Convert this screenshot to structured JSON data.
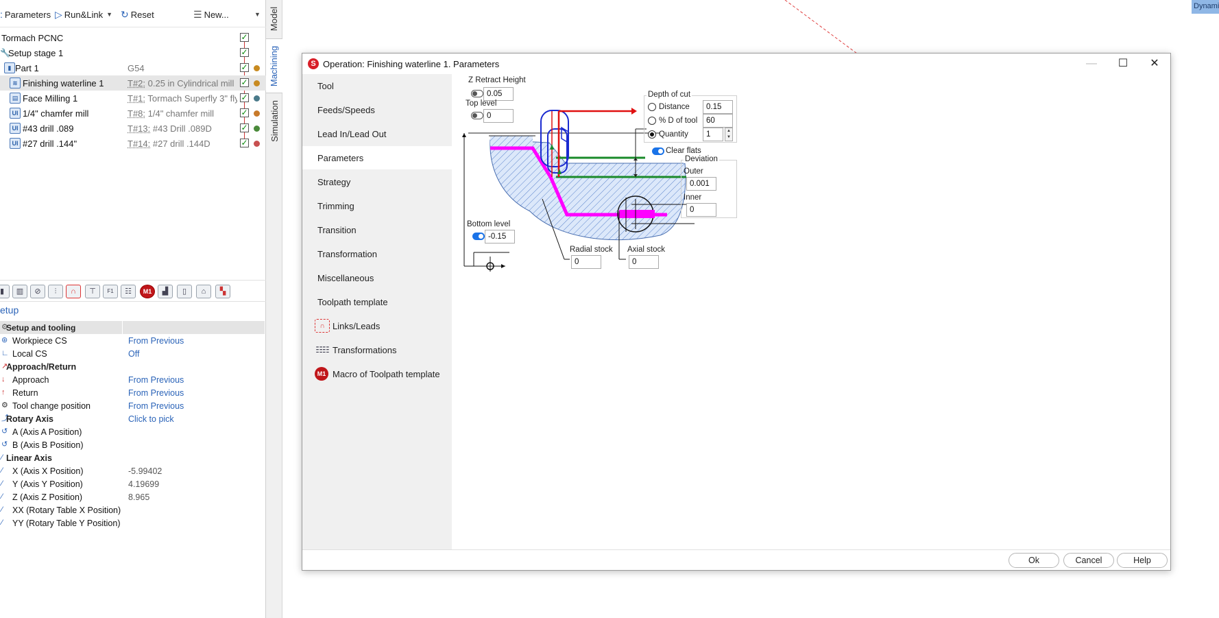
{
  "toolbar": {
    "parameters_label": "Parameters",
    "runlink_label": "Run&Link",
    "reset_label": "Reset",
    "new_label": "New..."
  },
  "tree": {
    "machine": "Tormach PCNC",
    "setup": "Setup stage 1",
    "part": {
      "name": "Part 1",
      "cs": "G54"
    },
    "operations": [
      {
        "name": "Finishing waterline 1",
        "tool_num": "T#2:",
        "tool": " 0.25 in Cylindrical mill",
        "dot": "#c88a20"
      },
      {
        "name": "Face Milling 1",
        "tool_num": "T#1:",
        "tool": " Tormach Superfly 3\" fly",
        "dot": "#4a7a8a"
      },
      {
        "name": "1/4\" chamfer mill",
        "tool_num": "T#8:",
        "tool": " 1/4\" chamfer mill",
        "dot": "#c87a2a"
      },
      {
        "name": "#43 drill .089",
        "tool_num": "T#13:",
        "tool": " #43  Drill .089D",
        "dot": "#4a8a3a"
      },
      {
        "name": "#27 drill .144\"",
        "tool_num": "T#14:",
        "tool": " #27 drill .144D",
        "dot": "#c85050"
      }
    ]
  },
  "side_tabs": {
    "model": "Model",
    "machining": "Machining",
    "simulation": "Simulation"
  },
  "setup_link": "etup",
  "props": {
    "group_setup": "Setup and tooling",
    "workpiece_cs": {
      "name": "Workpiece CS",
      "value": "From Previous"
    },
    "local_cs": {
      "name": "Local CS",
      "value": "Off"
    },
    "group_approach": "Approach/Return",
    "approach": {
      "name": "Approach",
      "value": "From Previous"
    },
    "return": {
      "name": "Return",
      "value": "From Previous"
    },
    "tool_change": {
      "name": "Tool change position",
      "value": "From Previous"
    },
    "group_rotary": "Rotary Axis",
    "rotary_value": "Click to pick",
    "axis_a": {
      "name": "A (Axis A Position)"
    },
    "axis_b": {
      "name": "B (Axis B Position)"
    },
    "group_linear": "Linear Axis",
    "axis_x": {
      "name": "X (Axis X Position)",
      "value": "-5.99402"
    },
    "axis_y": {
      "name": "Y (Axis Y Position)",
      "value": "4.19699"
    },
    "axis_z": {
      "name": "Z (Axis Z Position)",
      "value": "8.965"
    },
    "axis_xx": {
      "name": "XX (Rotary Table X Position)"
    },
    "axis_yy": {
      "name": "YY (Rotary Table Y Position)"
    }
  },
  "badge": "Dynami",
  "dialog": {
    "title": "Operation: Finishing waterline 1. Parameters",
    "nav": {
      "tool": "Tool",
      "feeds": "Feeds/Speeds",
      "lead": "Lead In/Lead Out",
      "parameters": "Parameters",
      "strategy": "Strategy",
      "trimming": "Trimming",
      "transition": "Transition",
      "transformation": "Transformation",
      "misc": "Miscellaneous",
      "toolpath": "Toolpath template",
      "links": "Links/Leads",
      "transformations": "Transformations",
      "macro": "Macro of Toolpath template"
    },
    "params": {
      "z_retract": {
        "label": "Z Retract Height",
        "value": "0.05"
      },
      "top_level": {
        "label": "Top level",
        "value": "0"
      },
      "bottom_level": {
        "label": "Bottom level",
        "value": "-0.15"
      },
      "depth_title": "Depth of cut",
      "distance": {
        "label": "Distance",
        "value": "0.15"
      },
      "pct_d": {
        "label": "% D of tool",
        "value": "60"
      },
      "quantity": {
        "label": "Quantity",
        "value": "1"
      },
      "clear_flats": "Clear flats",
      "deviation_title": "Deviation",
      "outer": {
        "label": "Outer",
        "value": "0.001"
      },
      "inner": {
        "label": "Inner",
        "value": "0"
      },
      "radial_stock": {
        "label": "Radial stock",
        "value": "0"
      },
      "axial_stock": {
        "label": "Axial stock",
        "value": "0"
      }
    },
    "buttons": {
      "ok": "Ok",
      "cancel": "Cancel",
      "help": "Help"
    }
  }
}
